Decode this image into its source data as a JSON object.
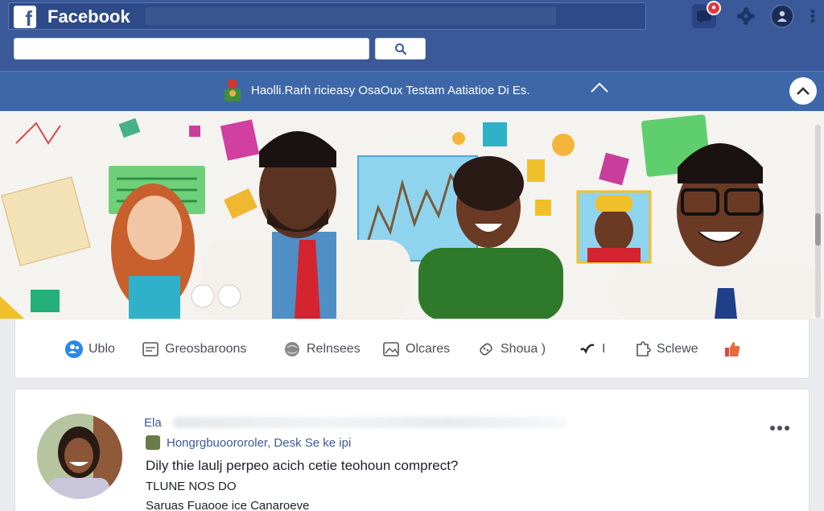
{
  "topbar": {
    "brand": "Facebook",
    "logo_letter": "f",
    "notifications_badge": "●",
    "search": {
      "placeholder": "",
      "value": ""
    }
  },
  "notice": {
    "text": "Haolli.Rarh ricieasy OsaOux Testam Aatiatioe Di Es."
  },
  "tabs": [
    {
      "label": "Ublo",
      "icon": "people-icon"
    },
    {
      "label": "Greosbaroons",
      "icon": "calendar-icon"
    },
    {
      "label": "Relnsees",
      "icon": "globe-icon"
    },
    {
      "label": "Olcares",
      "icon": "image-icon"
    },
    {
      "label": "Shoua )",
      "icon": "tag-icon"
    },
    {
      "label": "I",
      "icon": "check-icon"
    },
    {
      "label": "Sclewe",
      "icon": "puzzle-icon"
    },
    {
      "label": "",
      "icon": "like-icon"
    }
  ],
  "post": {
    "author": "Ela",
    "group": "Hongrgbuoororoler, Desk Se ke ipi",
    "body": "Dily thie laulj perpeo acich cetie teohoun comprect?",
    "meta1": "TLUNE NOS DO",
    "meta2": "Saruas Fuaooe ice Canaroeve"
  },
  "colors": {
    "brand_blue": "#3b5998",
    "notice_blue": "#3d67a8",
    "badge_red": "#e0393e"
  }
}
